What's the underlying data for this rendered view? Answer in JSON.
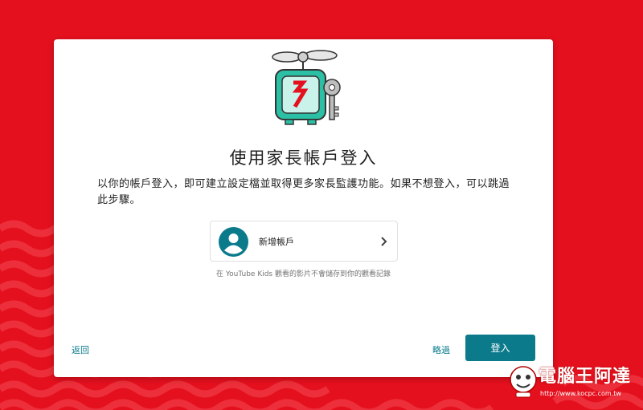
{
  "dialog": {
    "title": "使用家長帳戶登入",
    "description": "以你的帳戶登入，即可建立設定檔並取得更多家長監護功能。如果不想登入，可以跳過此步驟。",
    "account_option": {
      "label": "新增帳戶",
      "icon": "account-circle-icon"
    },
    "note": "在 YouTube Kids 觀看的影片不會儲存到你的觀看記錄",
    "back_label": "返回",
    "skip_label": "略過",
    "signin_label": "登入"
  },
  "watermark": {
    "text": "電腦王阿達",
    "url": "http://www.kocpc.com.tw"
  },
  "colors": {
    "background": "#e5101e",
    "accent": "#0b7b8c",
    "illustration_teal": "#2bbfa5"
  }
}
